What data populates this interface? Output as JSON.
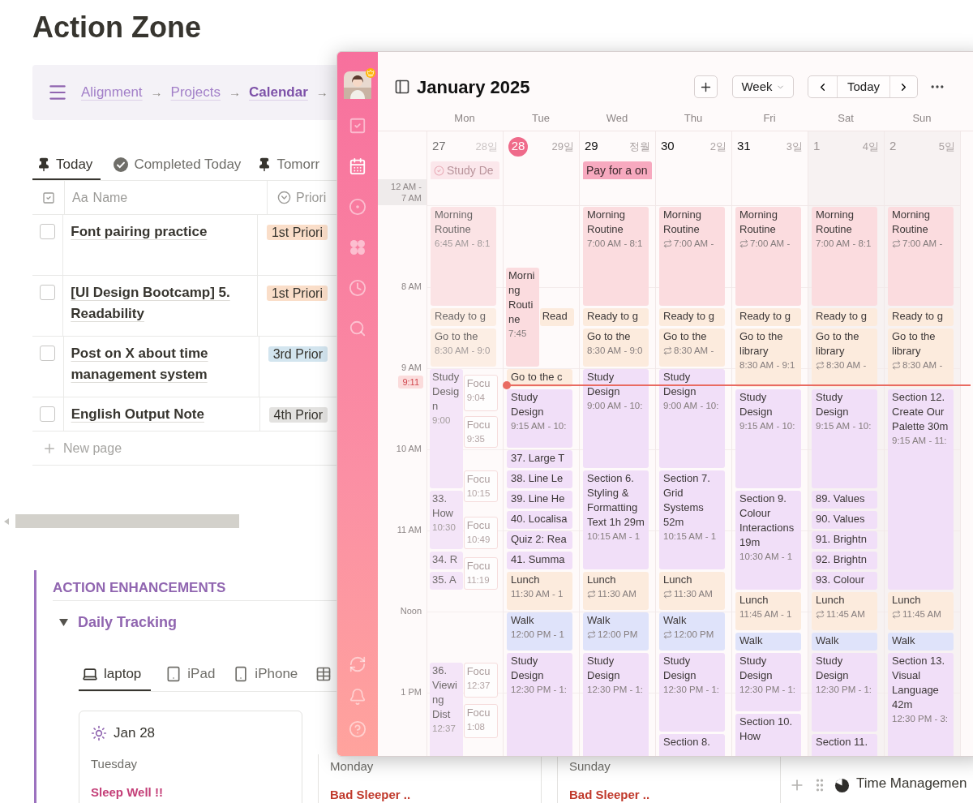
{
  "page": {
    "title": "Action Zone"
  },
  "breadcrumb": [
    {
      "label": "Alignment",
      "arrow": "→",
      "current": false
    },
    {
      "label": "Projects",
      "arrow": "→",
      "current": false
    },
    {
      "label": "Calendar",
      "arrow": "→",
      "current": true
    }
  ],
  "view_tabs": [
    {
      "label": "Today",
      "kind": "pin",
      "selected": true
    },
    {
      "label": "Completed Today",
      "kind": "check",
      "selected": false
    },
    {
      "label": "Tomorr",
      "kind": "pin",
      "selected": false
    }
  ],
  "table": {
    "columns": [
      {
        "label": "Name",
        "prefix": "Aa",
        "kind": "title"
      },
      {
        "label": "Priori",
        "kind": "select"
      }
    ],
    "rows": [
      {
        "checked": false,
        "name": "Font pairing practice",
        "priority": "1st Priori",
        "color": "#fadec9"
      },
      {
        "checked": false,
        "name": "[UI Design Bootcamp] 5. Readability",
        "priority": "1st Priori",
        "color": "#fadec9"
      },
      {
        "checked": false,
        "name": "Post on X about time management system",
        "priority": "3rd Prior",
        "color": "#d3e5ef"
      },
      {
        "checked": false,
        "name": "English Output Note",
        "priority": "4th Prior",
        "color": "#e3e2e0"
      }
    ],
    "new_page": "New page"
  },
  "section": {
    "title": "ACTION ENHANCEMENTS",
    "toggle": {
      "label": "Daily Tracking",
      "expanded": true
    },
    "device_tabs": [
      {
        "label": "laptop",
        "kind": "laptop",
        "selected": true
      },
      {
        "label": "iPad",
        "kind": "tablet",
        "selected": false
      },
      {
        "label": "iPhone",
        "kind": "phone",
        "selected": false
      },
      {
        "kind": "table",
        "selected": false
      }
    ],
    "cards": [
      {
        "date": "Jan 28",
        "weekday": "Tuesday",
        "note": "Sleep Well !!",
        "color": "#c43f78"
      },
      {
        "weekday": "Monday",
        "note": "Bad Sleeper ..",
        "color": "#c0392b"
      },
      {
        "weekday": "Sunday",
        "note": "Bad Sleeper ..",
        "color": "#c0392b"
      }
    ],
    "side_view": {
      "label": "Time Managemen"
    }
  },
  "calendar": {
    "title": "January 2025",
    "view": "Week",
    "today_button": "Today",
    "sidebar": {
      "top": [
        {
          "kind": "tasks",
          "selected": false
        },
        {
          "kind": "calendar",
          "selected": true
        },
        {
          "kind": "focus",
          "selected": false
        },
        {
          "kind": "apps",
          "selected": false
        },
        {
          "kind": "timer",
          "selected": false
        },
        {
          "kind": "search",
          "selected": false
        }
      ],
      "bottom": [
        {
          "kind": "sync",
          "selected": false
        },
        {
          "kind": "bell",
          "selected": false
        },
        {
          "kind": "help",
          "selected": false
        }
      ]
    },
    "collapsed_hours": "12 AM - 7 AM",
    "hour_labels": [
      "8 AM",
      "9 AM",
      "10 AM",
      "11 AM",
      "Noon",
      "1 PM"
    ],
    "now": {
      "label": "9:11"
    },
    "days": [
      {
        "name": "Mon",
        "date": "27",
        "lunar": "28일",
        "today": false,
        "past": true,
        "weekend": false,
        "all_day": [
          {
            "title": "Study De",
            "done": true,
            "color": "#fbe3e8"
          }
        ],
        "events": [
          {
            "title": "Morning Routine",
            "time": "6:45 AM - 8:1",
            "kind": "block",
            "color": "#fbdcdf",
            "repeat": false
          },
          {
            "title": "Ready to g",
            "kind": "block",
            "color": "#fcebdd",
            "repeat": false
          },
          {
            "title": "Go to the",
            "time": "8:30 AM - 9:0",
            "kind": "block",
            "color": "#fcebdd",
            "repeat": false
          },
          {
            "title": "Study Design",
            "time": "9:00",
            "kind": "block",
            "color": "#f1dff8",
            "repeat": false
          },
          {
            "title": "33. How",
            "time": "10:30",
            "kind": "block",
            "color": "#f1dff8",
            "repeat": false
          },
          {
            "title": "34. R",
            "kind": "block",
            "color": "#f1dff8",
            "repeat": false
          },
          {
            "title": "35. A",
            "kind": "block",
            "color": "#f1dff8",
            "repeat": false
          },
          {
            "title": "36. Viewing Dist",
            "time": "12:37",
            "kind": "block",
            "color": "#f1dff8",
            "repeat": false
          },
          {
            "title": "Focu",
            "time": "9:04",
            "kind": "focus",
            "color": "#ffffff",
            "repeat": false
          },
          {
            "title": "Focu",
            "time": "9:35",
            "kind": "focus",
            "color": "#ffffff",
            "repeat": false
          },
          {
            "title": "Focu",
            "time": "10:15",
            "kind": "focus",
            "color": "#ffffff",
            "repeat": false
          },
          {
            "title": "Focu",
            "time": "10:49",
            "kind": "focus",
            "color": "#ffffff",
            "repeat": false
          },
          {
            "title": "Focu",
            "time": "11:19",
            "kind": "focus",
            "color": "#ffffff",
            "repeat": false
          },
          {
            "title": "Focu",
            "time": "12:37",
            "kind": "focus",
            "color": "#ffffff",
            "repeat": false
          },
          {
            "title": "Focu",
            "time": "1:08",
            "kind": "focus",
            "color": "#ffffff",
            "repeat": false
          }
        ]
      },
      {
        "name": "Tue",
        "date": "28",
        "lunar": "29일",
        "today": true,
        "past": false,
        "weekend": false,
        "events": [
          {
            "title": "Morning Routine",
            "time": "7:45",
            "kind": "block",
            "color": "#fbdcdf",
            "repeat": false
          },
          {
            "title": "Read",
            "kind": "block",
            "color": "#fcebdd",
            "repeat": false
          },
          {
            "title": "Go to the c",
            "kind": "block",
            "color": "#fcebdd",
            "repeat": false
          },
          {
            "title": "Study Design",
            "time": "9:15 AM - 10:",
            "kind": "block",
            "color": "#f1dff8",
            "repeat": false
          },
          {
            "title": "37. Large T",
            "kind": "block",
            "color": "#f1dff8",
            "repeat": false
          },
          {
            "title": "38. Line Le",
            "kind": "block",
            "color": "#f1dff8",
            "repeat": false
          },
          {
            "title": "39. Line He",
            "kind": "block",
            "color": "#f1dff8",
            "repeat": false
          },
          {
            "title": "40. Localisa",
            "kind": "block",
            "color": "#f1dff8",
            "repeat": false
          },
          {
            "title": "Quiz 2: Rea",
            "kind": "block",
            "color": "#f1dff8",
            "repeat": false
          },
          {
            "title": "41. Summa",
            "kind": "block",
            "color": "#f1dff8",
            "repeat": false
          },
          {
            "title": "Lunch",
            "time": "11:30 AM - 1",
            "kind": "block",
            "color": "#fcebdd",
            "repeat": false
          },
          {
            "title": "Walk",
            "time": "12:00 PM - 1",
            "kind": "block",
            "color": "#dfe3fa",
            "repeat": false
          },
          {
            "title": "Study Design",
            "time": "12:30 PM - 1:",
            "kind": "block",
            "color": "#f1dff8",
            "repeat": false
          }
        ]
      },
      {
        "name": "Wed",
        "date": "29",
        "lunar": "정월",
        "today": false,
        "past": false,
        "weekend": false,
        "all_day": [
          {
            "title": "Pay for a on",
            "done": false,
            "color": "#f7a9bf"
          }
        ],
        "events": [
          {
            "title": "Morning Routine",
            "time": "7:00 AM - 8:1",
            "kind": "block",
            "color": "#fbdcdf",
            "repeat": false
          },
          {
            "title": "Ready to g",
            "kind": "block",
            "color": "#fcebdd",
            "repeat": false
          },
          {
            "title": "Go to the",
            "time": "8:30 AM - 9:0",
            "kind": "block",
            "color": "#fcebdd",
            "repeat": false
          },
          {
            "title": "Study Design",
            "time": "9:00 AM - 10:",
            "kind": "block",
            "color": "#f1dff8",
            "repeat": false
          },
          {
            "title": "Section 6. Styling & Formatting Text 1h 29m",
            "time": "10:15 AM - 1",
            "kind": "block",
            "color": "#f1dff8",
            "repeat": false
          },
          {
            "title": "Lunch",
            "time": "11:30 AM",
            "kind": "block",
            "color": "#fcebdd",
            "repeat": true
          },
          {
            "title": "Walk",
            "time": "12:00 PM",
            "kind": "block",
            "color": "#dfe3fa",
            "repeat": true
          },
          {
            "title": "Study Design",
            "time": "12:30 PM - 1:",
            "kind": "block",
            "color": "#f1dff8",
            "repeat": false
          }
        ]
      },
      {
        "name": "Thu",
        "date": "30",
        "lunar": "2일",
        "today": false,
        "past": false,
        "weekend": false,
        "events": [
          {
            "title": "Morning Routine",
            "time": "7:00 AM -",
            "kind": "block",
            "color": "#fbdcdf",
            "repeat": true
          },
          {
            "title": "Ready to g",
            "kind": "block",
            "color": "#fcebdd",
            "repeat": false
          },
          {
            "title": "Go to the",
            "time": "8:30 AM -",
            "kind": "block",
            "color": "#fcebdd",
            "repeat": true
          },
          {
            "title": "Study Design",
            "time": "9:00 AM - 10:",
            "kind": "block",
            "color": "#f1dff8",
            "repeat": false
          },
          {
            "title": "Section 7. Grid Systems 52m",
            "time": "10:15 AM - 1",
            "kind": "block",
            "color": "#f1dff8",
            "repeat": false
          },
          {
            "title": "Lunch",
            "time": "11:30 AM",
            "kind": "block",
            "color": "#fcebdd",
            "repeat": true
          },
          {
            "title": "Walk",
            "time": "12:00 PM",
            "kind": "block",
            "color": "#dfe3fa",
            "repeat": true
          },
          {
            "title": "Study Design",
            "time": "12:30 PM - 1:",
            "kind": "block",
            "color": "#f1dff8",
            "repeat": false
          },
          {
            "title": "Section 8.",
            "kind": "block",
            "color": "#f1dff8",
            "repeat": false
          }
        ]
      },
      {
        "name": "Fri",
        "date": "31",
        "lunar": "3일",
        "today": false,
        "past": false,
        "weekend": false,
        "events": [
          {
            "title": "Morning Routine",
            "time": "7:00 AM -",
            "kind": "block",
            "color": "#fbdcdf",
            "repeat": true
          },
          {
            "title": "Ready to g",
            "kind": "block",
            "color": "#fcebdd",
            "repeat": false
          },
          {
            "title": "Go to the library",
            "time": "8:30 AM - 9:1",
            "kind": "block",
            "color": "#fcebdd",
            "repeat": false
          },
          {
            "title": "Study Design",
            "time": "9:15 AM - 10:",
            "kind": "block",
            "color": "#f1dff8",
            "repeat": false
          },
          {
            "title": "Section 9. Colour Interactions 19m",
            "time": "10:30 AM - 1",
            "kind": "block",
            "color": "#f1dff8",
            "repeat": false
          },
          {
            "title": "Lunch",
            "time": "11:45 AM - 1",
            "kind": "block",
            "color": "#fcebdd",
            "repeat": false
          },
          {
            "title": "Walk",
            "kind": "block",
            "color": "#dfe3fa",
            "repeat": false
          },
          {
            "title": "Study Design",
            "time": "12:30 PM - 1:",
            "kind": "block",
            "color": "#f1dff8",
            "repeat": false
          },
          {
            "title": "Section 10. How",
            "kind": "block",
            "color": "#f1dff8",
            "repeat": false
          }
        ]
      },
      {
        "name": "Sat",
        "date": "1",
        "lunar": "4일",
        "today": false,
        "past": false,
        "weekend": true,
        "events": [
          {
            "title": "Morning Routine",
            "time": "7:00 AM - 8:1",
            "kind": "block",
            "color": "#fbdcdf",
            "repeat": false
          },
          {
            "title": "Ready to g",
            "kind": "block",
            "color": "#fcebdd",
            "repeat": false
          },
          {
            "title": "Go to the library",
            "time": "8:30 AM -",
            "kind": "block",
            "color": "#fcebdd",
            "repeat": true
          },
          {
            "title": "Study Design",
            "time": "9:15 AM - 10:",
            "kind": "block",
            "color": "#f1dff8",
            "repeat": false
          },
          {
            "title": "89. Values",
            "kind": "block",
            "color": "#f1dff8",
            "repeat": false
          },
          {
            "title": "90. Values",
            "kind": "block",
            "color": "#f1dff8",
            "repeat": false
          },
          {
            "title": "91. Brightn",
            "kind": "block",
            "color": "#f1dff8",
            "repeat": false
          },
          {
            "title": "92. Brightn",
            "kind": "block",
            "color": "#f1dff8",
            "repeat": false
          },
          {
            "title": "93. Colour",
            "kind": "block",
            "color": "#f1dff8",
            "repeat": false
          },
          {
            "title": "Lunch",
            "time": "11:45 AM",
            "kind": "block",
            "color": "#fcebdd",
            "repeat": true
          },
          {
            "title": "Walk",
            "kind": "block",
            "color": "#dfe3fa",
            "repeat": false
          },
          {
            "title": "Study Design",
            "time": "12:30 PM - 1:",
            "kind": "block",
            "color": "#f1dff8",
            "repeat": false
          },
          {
            "title": "Section 11.",
            "kind": "block",
            "color": "#f1dff8",
            "repeat": false
          }
        ]
      },
      {
        "name": "Sun",
        "date": "2",
        "lunar": "5일",
        "today": false,
        "past": false,
        "weekend": true,
        "events": [
          {
            "title": "Morning Routine",
            "time": "7:00 AM -",
            "kind": "block",
            "color": "#fbdcdf",
            "repeat": true
          },
          {
            "title": "Ready to g",
            "kind": "block",
            "color": "#fcebdd",
            "repeat": false
          },
          {
            "title": "Go to the library",
            "time": "8:30 AM -",
            "kind": "block",
            "color": "#fcebdd",
            "repeat": true
          },
          {
            "title": "Section 12. Create Our Palette 30m",
            "time": "9:15 AM - 11:",
            "kind": "block",
            "color": "#f1dff8",
            "repeat": false
          },
          {
            "title": "Lunch",
            "time": "11:45 AM",
            "kind": "block",
            "color": "#fcebdd",
            "repeat": true
          },
          {
            "title": "Walk",
            "kind": "block",
            "color": "#dfe3fa",
            "repeat": false
          },
          {
            "title": "Section 13. Visual Language 42m",
            "time": "12:30 PM - 3:",
            "kind": "block",
            "color": "#f1dff8",
            "repeat": false
          }
        ]
      }
    ]
  }
}
